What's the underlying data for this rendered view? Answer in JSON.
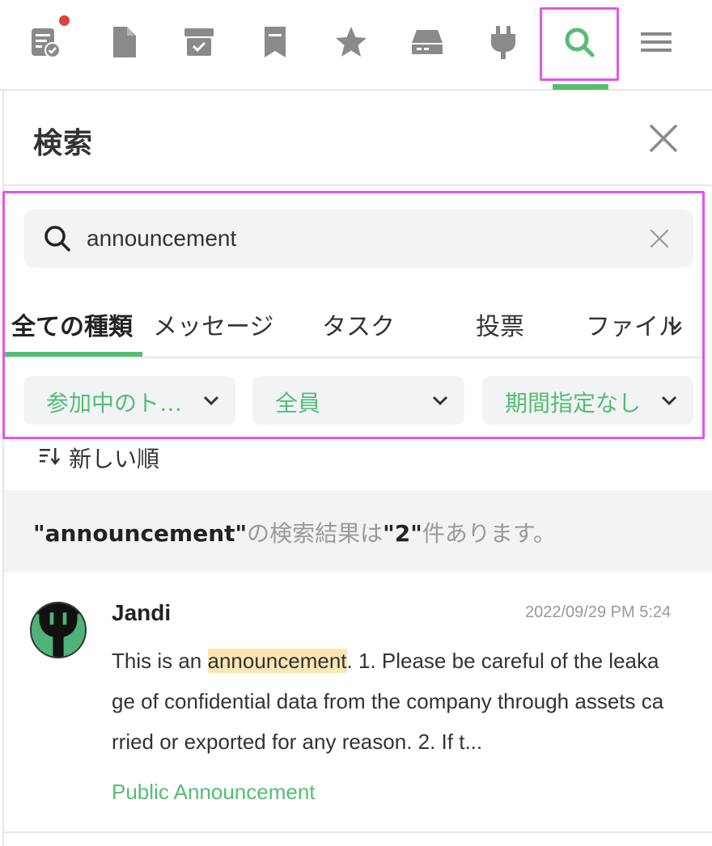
{
  "toolbar": {
    "items": [
      {
        "name": "task-list-icon"
      },
      {
        "name": "file-icon"
      },
      {
        "name": "archive-check-icon"
      },
      {
        "name": "bookmark-icon"
      },
      {
        "name": "star-icon"
      },
      {
        "name": "drive-icon"
      },
      {
        "name": "plug-icon"
      },
      {
        "name": "search-icon",
        "active": true
      },
      {
        "name": "menu-icon"
      }
    ],
    "accent_color": "#55bd73",
    "notification_color": "#e0413b"
  },
  "panel": {
    "title": "検索",
    "close_icon": "close-icon"
  },
  "search": {
    "query": "announcement",
    "icon": "search-icon",
    "clear_icon": "clear-icon"
  },
  "tabs": [
    {
      "label": "全ての種類",
      "active": true
    },
    {
      "label": "メッセージ"
    },
    {
      "label": "タスク"
    },
    {
      "label": "投票"
    },
    {
      "label": "ファイル"
    }
  ],
  "filters": [
    {
      "label": "参加中のト…"
    },
    {
      "label": "全員"
    },
    {
      "label": "期間指定なし"
    }
  ],
  "sort": {
    "label": "新しい順",
    "icon": "sort-icon"
  },
  "summary": {
    "quote_open": "\"",
    "query": "announcement",
    "quote_close": "\"",
    "middle_text": "の検索結果は",
    "count_quote_open": "\"",
    "count": "2",
    "count_quote_close": "\"",
    "suffix": "件あります。"
  },
  "results": [
    {
      "sender": "Jandi",
      "timestamp": "2022/09/29 PM 5:24",
      "snippet_before": "This is an ",
      "snippet_highlight": "announcement",
      "snippet_after": ". 1. Please be careful of the leakage of confidential data from the company through assets carried or exported for any reason. 2. If t...",
      "topic": "Public Announcement",
      "avatar_color": "#4fb27b"
    }
  ]
}
